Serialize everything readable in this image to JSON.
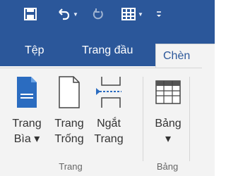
{
  "qat": {
    "save_icon": "save-icon",
    "undo_icon": "undo-icon",
    "redo_icon": "redo-icon",
    "table_icon": "table-icon",
    "customize_icon": "customize-qat-icon"
  },
  "tabs": {
    "file": "Tệp",
    "home": "Trang đầu",
    "insert": "Chèn"
  },
  "ribbon": {
    "pages_group": {
      "label": "Trang",
      "cover_page": "Trang\nBìa ▾",
      "blank_page": "Trang\nTrống",
      "page_break": "Ngắt\nTrang"
    },
    "tables_group": {
      "label": "Bảng",
      "table": "Bảng\n▾"
    }
  },
  "colors": {
    "title_bar": "#2b579a",
    "ribbon_bg": "#f3f3f3",
    "accent_blue": "#2b6cc0"
  }
}
